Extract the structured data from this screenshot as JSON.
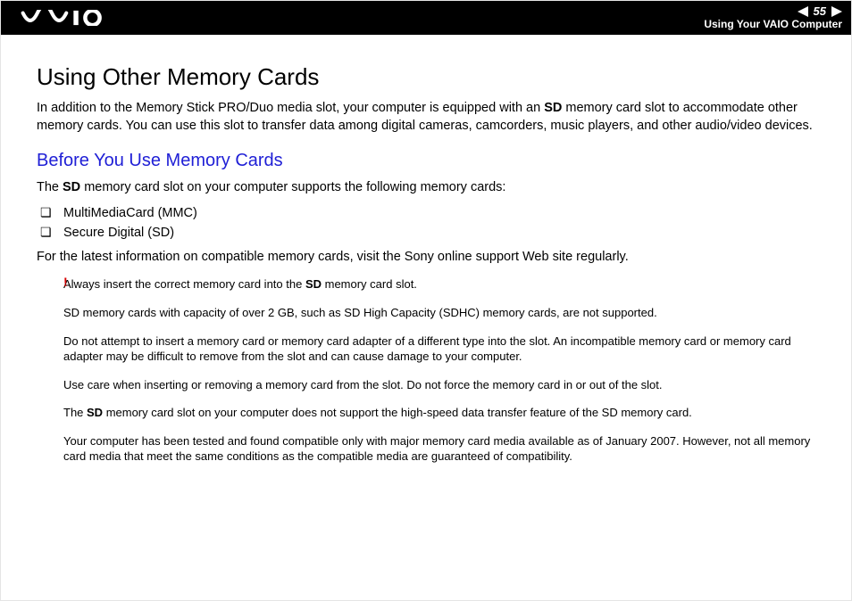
{
  "header": {
    "page_number": "55",
    "section": "Using Your VAIO Computer"
  },
  "content": {
    "h1": "Using Other Memory Cards",
    "intro_parts": [
      "In addition to the Memory Stick PRO/Duo media slot, your computer is equipped with an ",
      "SD",
      " memory card slot to accommodate other memory cards. You can use this slot to transfer data among digital cameras, camcorders, music players, and other audio/video devices."
    ],
    "h2": "Before You Use Memory Cards",
    "sub_intro_parts": [
      "The ",
      "SD",
      " memory card slot on your computer supports the following memory cards:"
    ],
    "cards": [
      "MultiMediaCard (MMC)",
      "Secure Digital (SD)"
    ],
    "latest": "For the latest information on compatible memory cards, visit the Sony online support Web site regularly.",
    "bang": "!",
    "notes": [
      [
        "Always insert the correct memory card into the ",
        "SD",
        " memory card slot."
      ],
      [
        "SD memory cards with capacity of over 2 GB, such as SD High Capacity (SDHC) memory cards, are not supported."
      ],
      [
        "Do not attempt to insert a memory card or memory card adapter of a different type into the slot. An incompatible memory card or memory card adapter may be difficult to remove from the slot and can cause damage to your computer."
      ],
      [
        "Use care when inserting or removing a memory card from the slot. Do not force the memory card in or out of the slot."
      ],
      [
        "The ",
        "SD",
        " memory card slot on your computer does not support the high-speed data transfer feature of the SD memory card."
      ],
      [
        "Your computer has been tested and found compatible only with major memory card media available as of January 2007. However, not all memory card media that meet the same conditions as the compatible media are guaranteed of compatibility."
      ]
    ]
  }
}
